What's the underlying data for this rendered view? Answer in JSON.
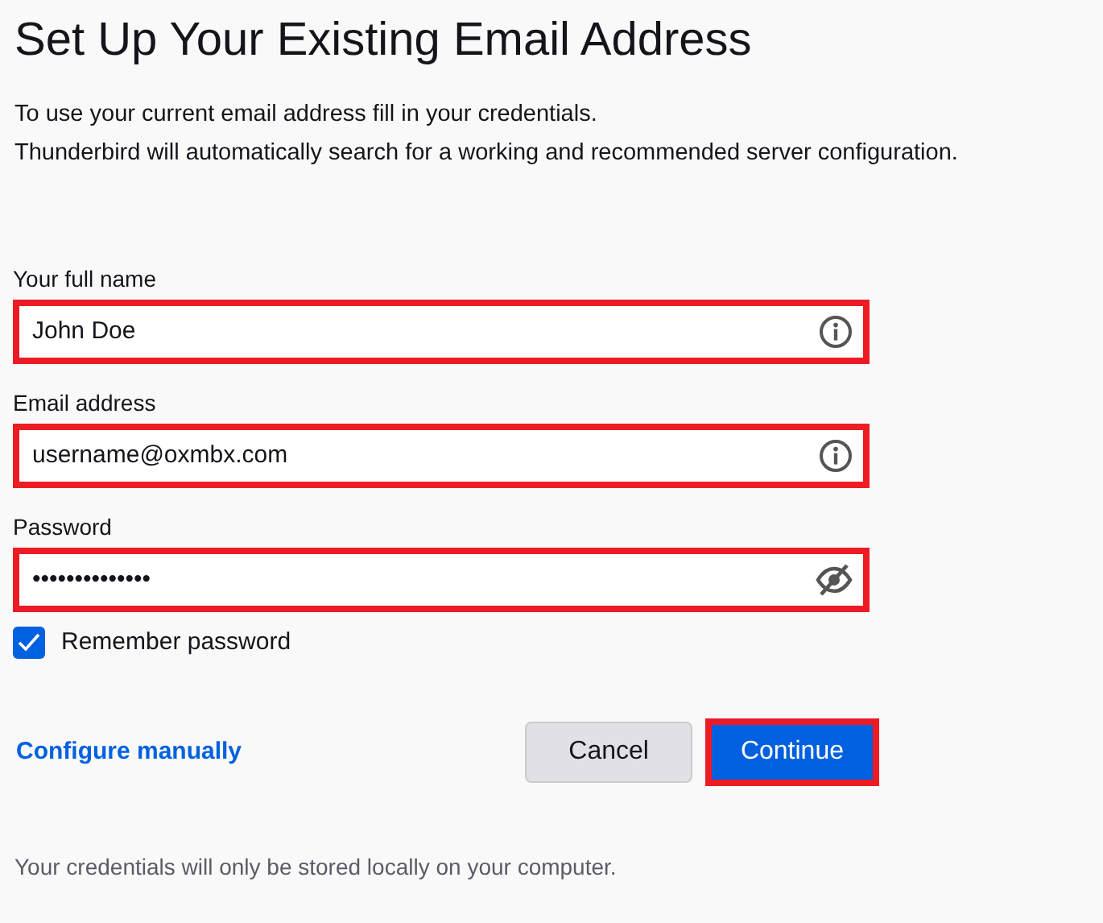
{
  "title": "Set Up Your Existing Email Address",
  "intro": [
    "To use your current email address fill in your credentials.",
    "Thunderbird will automatically search for a working and recommended server configuration."
  ],
  "fields": [
    {
      "label": "Your full name",
      "value": "John Doe",
      "kind": "info",
      "highlighted": true
    },
    {
      "label": "Email address",
      "value": "username@oxmbx.com",
      "kind": "info",
      "highlighted": true
    },
    {
      "label": "Password",
      "value": "••••••••••••••",
      "kind": "password",
      "highlighted": true
    }
  ],
  "remember": {
    "label": "Remember password",
    "checked": true
  },
  "configure_link": "Configure manually",
  "buttons": [
    {
      "label": "Cancel",
      "kind": "secondary",
      "highlighted": false
    },
    {
      "label": "Continue",
      "kind": "primary",
      "highlighted": true
    }
  ],
  "footer": "Your credentials will only be stored locally on your computer."
}
